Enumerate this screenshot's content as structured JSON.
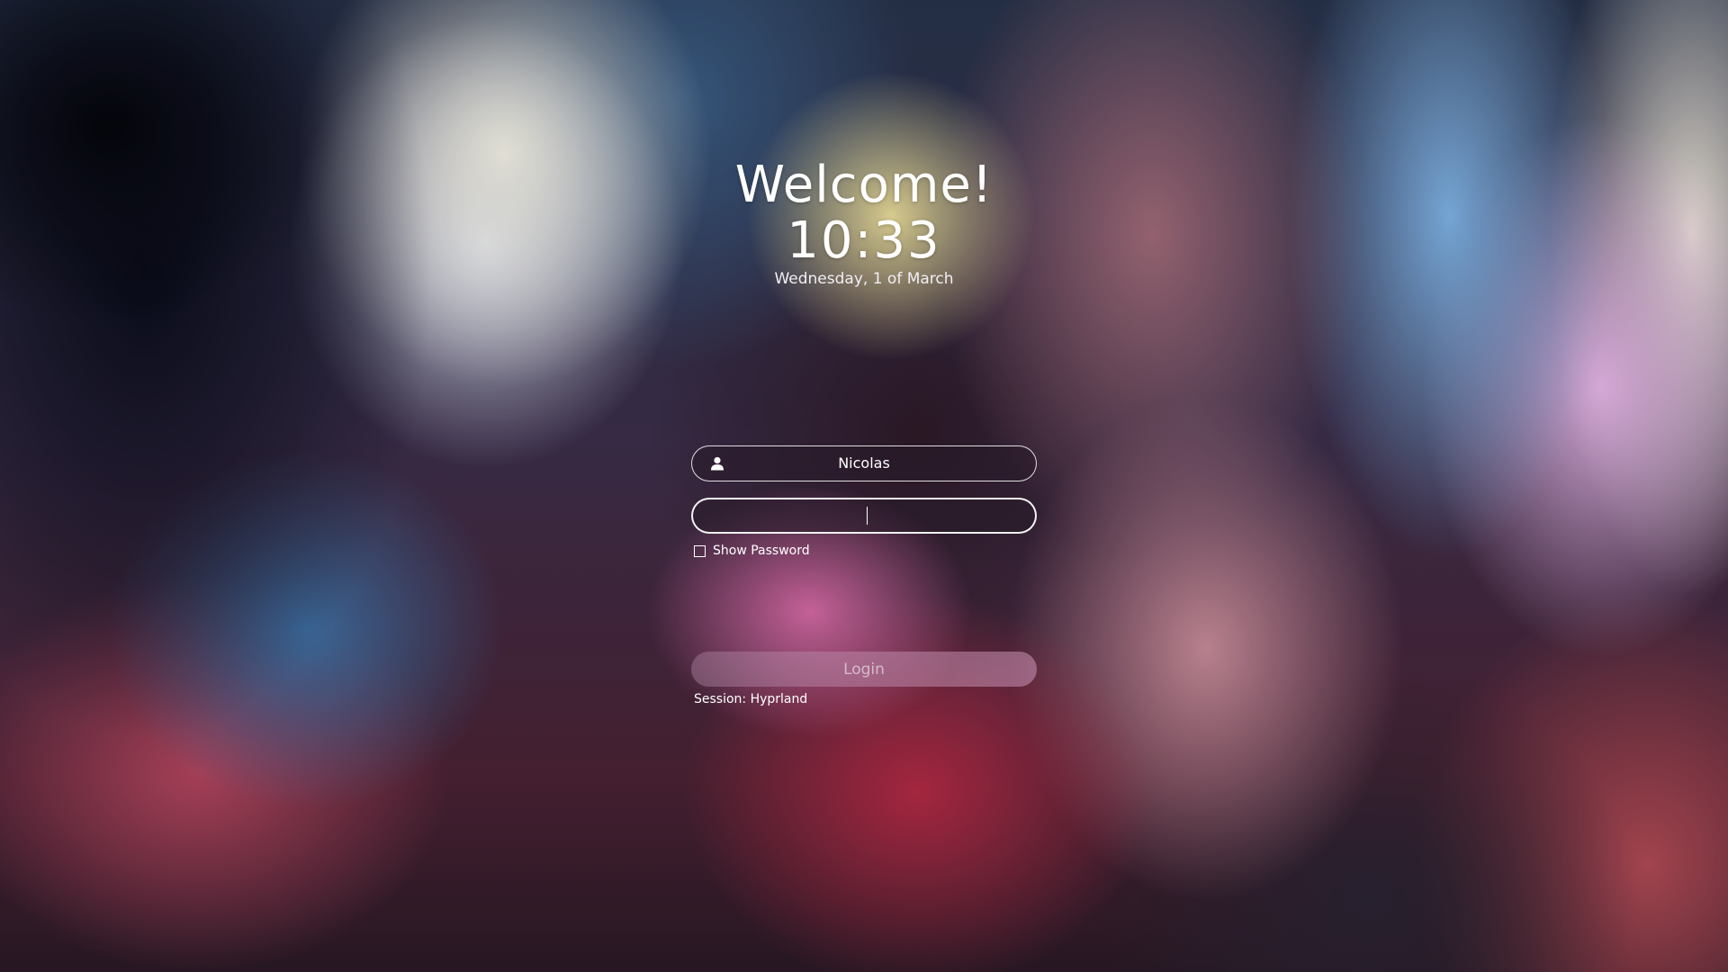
{
  "greeter": {
    "welcome": "Welcome!",
    "time": "10:33",
    "date": "Wednesday, 1 of March"
  },
  "login_form": {
    "username": "Nicolas",
    "username_icon": "user-icon",
    "password_value": "",
    "show_password_label": "Show Password",
    "show_password_checked": false,
    "login_label": "Login",
    "session_label": "Session: Hyprland"
  }
}
